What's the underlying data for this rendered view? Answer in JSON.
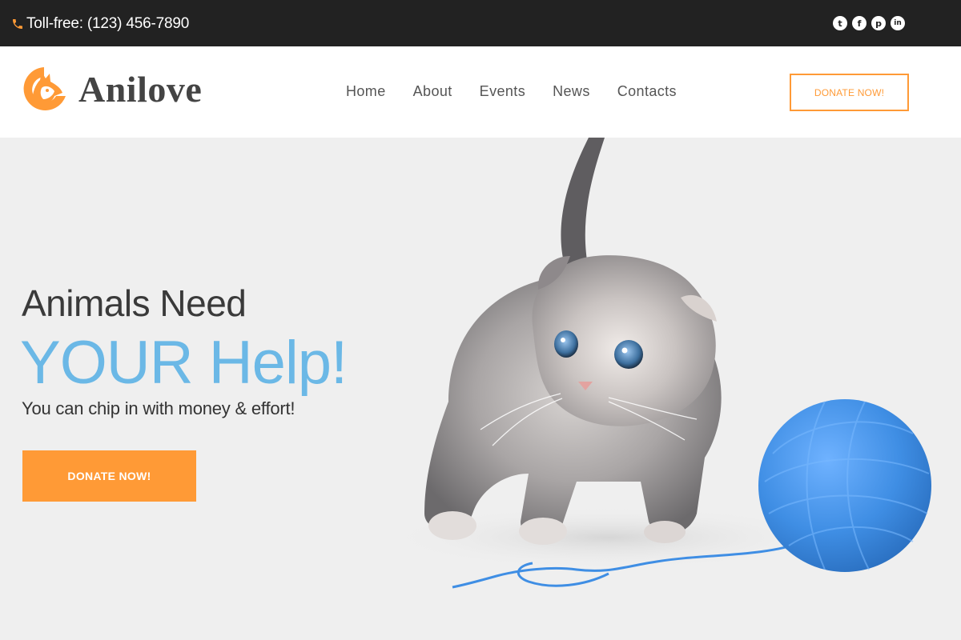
{
  "topbar": {
    "phone_text": "Toll-free: (123) 456-7890",
    "phone_icon": "phone-icon",
    "socials": [
      {
        "icon": "twitter-icon",
        "glyph": "t"
      },
      {
        "icon": "facebook-icon",
        "glyph": "f"
      },
      {
        "icon": "pinterest-icon",
        "glyph": "p"
      },
      {
        "icon": "linkedin-icon",
        "glyph": "in"
      }
    ]
  },
  "header": {
    "logo_text": "Anilove",
    "nav": [
      "Home",
      "About",
      "Events",
      "News",
      "Contacts"
    ],
    "donate_label": "DONATE NOW!"
  },
  "hero": {
    "line1": "Animals Need",
    "line2": "YOUR Help!",
    "subtitle": "You can chip in with money & effort!",
    "donate_label": "DONATE NOW!"
  },
  "colors": {
    "accent_orange": "#ff9a36",
    "headline_blue": "#6bb8e6",
    "topbar_bg": "#222222",
    "hero_bg": "#efefef"
  }
}
